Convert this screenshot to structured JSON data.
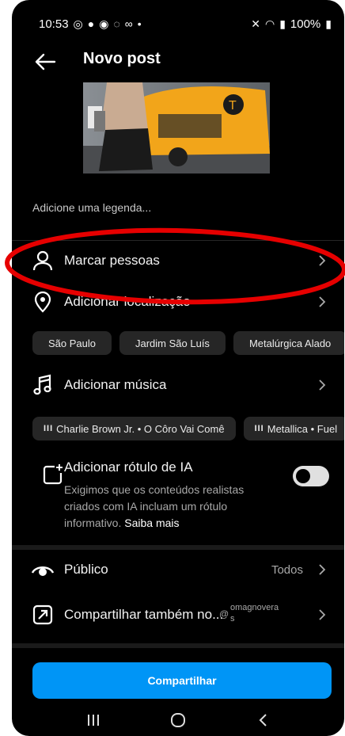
{
  "status_bar": {
    "time": "10:53",
    "battery": "100%"
  },
  "header": {
    "title": "Novo post"
  },
  "caption": {
    "placeholder": "Adicione uma legenda..."
  },
  "rows": {
    "tag_people": "Marcar pessoas",
    "add_location": "Adicionar localização",
    "add_music": "Adicionar música",
    "audience": "Público",
    "audience_value": "Todos",
    "share_also": "Compartilhar também no...",
    "threads_account_line1": "omagnovera",
    "threads_account_line2": "s"
  },
  "location_suggestions": [
    "São Paulo",
    "Jardim São Luís",
    "Metalúrgica Alado"
  ],
  "music_suggestions": [
    "Charlie Brown Jr. • O Côro Vai Comê",
    "Metallica • Fuel"
  ],
  "ai_label": {
    "title": "Adicionar rótulo de IA",
    "description": "Exigimos que os conteúdos realistas criados com IA incluam um rótulo informativo.",
    "learn_more": "Saiba mais",
    "enabled": false
  },
  "share_button": "Compartilhar",
  "colors": {
    "background": "#000000",
    "accent": "#0095f6",
    "annotation": "#e60000"
  }
}
